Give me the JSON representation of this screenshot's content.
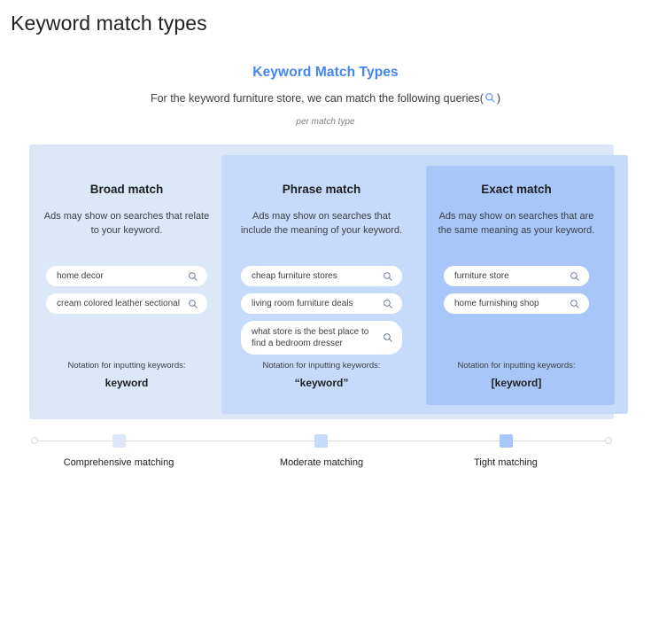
{
  "page": {
    "title": "Keyword match types"
  },
  "infographic": {
    "heading": "Keyword Match Types",
    "subheading_prefix": "For the keyword furniture store, we can match the following queries",
    "paren_open": "(",
    "paren_close": ")",
    "search_icon": "search-icon",
    "footnote": "per match type",
    "heading_color": "#4285f4",
    "panel_colors": {
      "broad": "#dde7fa",
      "phrase": "#c6dbfa",
      "exact": "#a8c7f8"
    }
  },
  "columns": [
    {
      "key": "broad",
      "title": "Broad match",
      "description": "Ads may show on searches that relate to your keyword.",
      "queries": [
        "home decor",
        "cream colored leather sectional"
      ],
      "notation_label": "Notation for inputting keywords:",
      "notation_value": "keyword"
    },
    {
      "key": "phrase",
      "title": "Phrase match",
      "description": "Ads may show on searches that include the meaning of your keyword.",
      "queries": [
        "cheap furniture stores",
        "living room furniture deals",
        "what store is the best place to find a bedroom dresser"
      ],
      "notation_label": "Notation for inputting keywords:",
      "notation_value": "“keyword”"
    },
    {
      "key": "exact",
      "title": "Exact match",
      "description": "Ads may show on searches that are the same meaning as your keyword.",
      "queries": [
        "furniture store",
        "home furnishing shop"
      ],
      "notation_label": "Notation for inputting keywords:",
      "notation_value": "[keyword]"
    }
  ],
  "slider": {
    "stops": [
      {
        "label": "Comprehensive matching",
        "color": "#dde7fa"
      },
      {
        "label": "Moderate matching",
        "color": "#c6dbfa"
      },
      {
        "label": "Tight matching",
        "color": "#a8c7f8"
      }
    ]
  }
}
